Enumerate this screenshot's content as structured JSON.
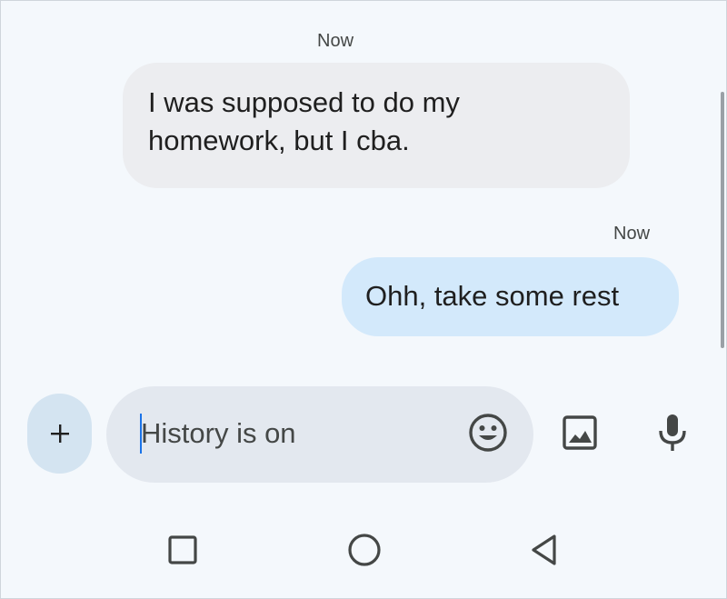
{
  "messages": [
    {
      "direction": "incoming",
      "timestamp": "Now",
      "text": "I was supposed to do my homework, but I cba."
    },
    {
      "direction": "outgoing",
      "timestamp": "Now",
      "text": "Ohh, take some rest"
    }
  ],
  "compose": {
    "placeholder": "History is on",
    "value": ""
  },
  "icons": {
    "add": "plus-icon",
    "emoji": "emoji-icon",
    "attach_image": "image-icon",
    "voice": "microphone-icon",
    "nav_recents": "square-icon",
    "nav_home": "circle-icon",
    "nav_back": "triangle-back-icon"
  },
  "colors": {
    "background": "#f4f8fc",
    "incoming_bubble": "#ecedf0",
    "outgoing_bubble": "#d3e9fb",
    "compose_field": "#e3e8ef",
    "add_button": "#d4e4f1",
    "caret": "#1a73e8",
    "icon": "#444746"
  }
}
